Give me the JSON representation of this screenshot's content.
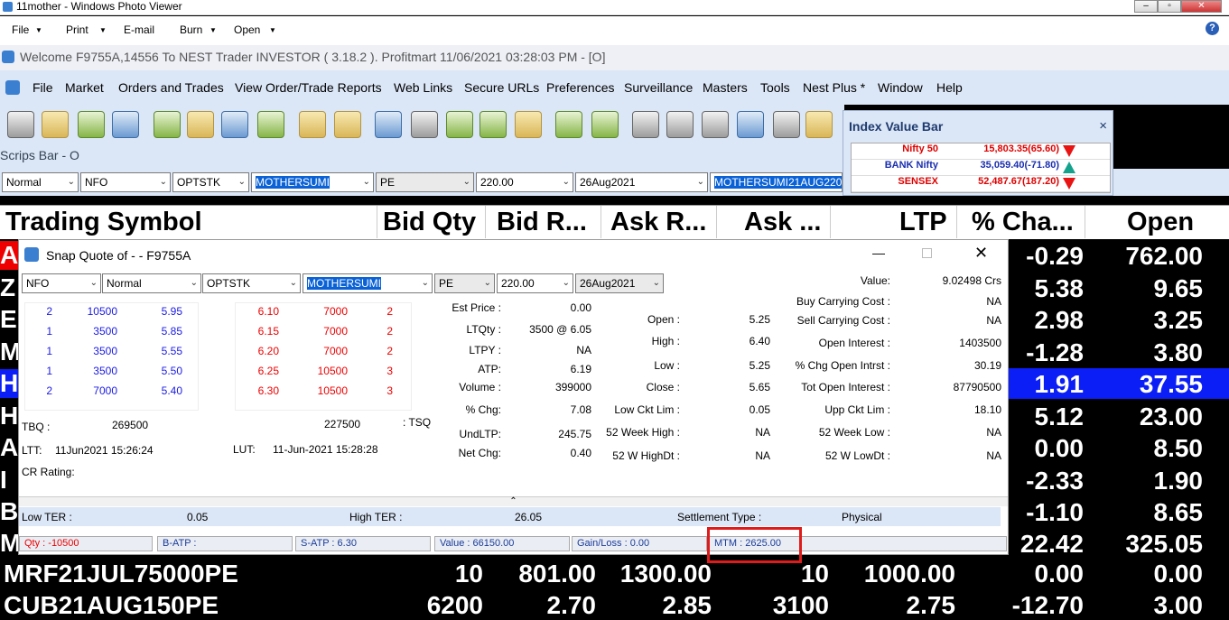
{
  "window": {
    "title": "11mother - Windows Photo Viewer",
    "menu": [
      "File",
      "Print",
      "E-mail",
      "Burn",
      "Open"
    ],
    "help": "?"
  },
  "welcome": "Welcome F9755A,14556 To NEST Trader INVESTOR ( 3.18.2 ).  Profitmart  11/06/2021  03:28:03 PM - [O]",
  "main_menu": [
    "File",
    "Market",
    "Orders and Trades",
    "View Order/Trade Reports",
    "Web Links",
    "Secure URLs",
    "Preferences",
    "Surveillance",
    "Masters",
    "Tools",
    "Nest Plus *",
    "Window",
    "Help"
  ],
  "scrips_bar": "Scrips Bar - O",
  "selectors": [
    "Normal",
    "NFO",
    "OPTSTK",
    "MOTHERSUMI",
    "PE",
    "220.00",
    "26Aug2021",
    "MOTHERSUMI21AUG220PE"
  ],
  "index_bar": {
    "title": "Index Value Bar",
    "close": "×",
    "rows": [
      {
        "name": "Nifty 50",
        "value": "15,803.35(65.60)",
        "dir": "down",
        "color": "#e00000"
      },
      {
        "name": "BANK Nifty",
        "value": "35,059.40(-71.80)",
        "dir": "up",
        "color": "#1a2fb0"
      },
      {
        "name": "SENSEX",
        "value": "52,487.67(187.20)",
        "dir": "down",
        "color": "#e00000"
      }
    ]
  },
  "market_watch": {
    "headers": [
      "Trading Symbol",
      "Bid Qty",
      "Bid R...",
      "Ask R...",
      "Ask ...",
      "LTP",
      "% Cha...",
      "Open"
    ],
    "left_letters": [
      "A",
      "Z",
      "E",
      "M",
      "H",
      "H",
      "A",
      "I",
      "B",
      "M"
    ],
    "pct_chg": [
      "-0.29",
      "5.38",
      "2.98",
      "-1.28",
      "1.91",
      "5.12",
      "0.00",
      "-2.33",
      "-1.10",
      "22.42"
    ],
    "open": [
      "762.00",
      "9.65",
      "3.25",
      "3.80",
      "37.55",
      "23.00",
      "8.50",
      "1.90",
      "8.65",
      "325.05"
    ],
    "bottom_rows": [
      [
        "MRF21JUL75000PE",
        "10",
        "801.00",
        "1300.00",
        "10",
        "1000.00",
        "0.00",
        "0.00"
      ],
      [
        "CUB21AUG150PE",
        "6200",
        "2.70",
        "2.85",
        "3100",
        "2.75",
        "-12.70",
        "3.00"
      ]
    ]
  },
  "snap_quote": {
    "title": "Snap Quote of  -  - F9755A",
    "selectors": [
      "NFO",
      "Normal",
      "OPTSTK",
      "MOTHERSUMI",
      "PE",
      "220.00",
      "26Aug2021"
    ],
    "bids": [
      [
        "2",
        "10500",
        "5.95"
      ],
      [
        "1",
        "3500",
        "5.85"
      ],
      [
        "1",
        "3500",
        "5.55"
      ],
      [
        "1",
        "3500",
        "5.50"
      ],
      [
        "2",
        "7000",
        "5.40"
      ]
    ],
    "asks": [
      [
        "6.10",
        "7000",
        "2"
      ],
      [
        "6.15",
        "7000",
        "2"
      ],
      [
        "6.20",
        "7000",
        "2"
      ],
      [
        "6.25",
        "10500",
        "3"
      ],
      [
        "6.30",
        "10500",
        "3"
      ]
    ],
    "tbq_label": "TBQ :",
    "tbq": "269500",
    "tsq": "227500",
    "tsq_label": ": TSQ",
    "ltt_label": "LTT:",
    "ltt": "11Jun2021 15:26:24",
    "lut_label": "LUT:",
    "lut": "11-Jun-2021 15:28:28",
    "cr_label": "CR Rating:",
    "c1": [
      [
        "Est Price :",
        "0.00"
      ],
      [
        "LTQty :",
        "3500 @ 6.05"
      ],
      [
        "LTPY :",
        "NA"
      ],
      [
        "ATP:",
        "6.19"
      ],
      [
        "Volume :",
        "399000"
      ],
      [
        "% Chg:",
        "7.08"
      ],
      [
        "UndLTP:",
        "245.75"
      ],
      [
        "Net Chg:",
        "0.40"
      ]
    ],
    "c2": [
      [
        "Open :",
        "5.25"
      ],
      [
        "High :",
        "6.40"
      ],
      [
        "Low :",
        "5.25"
      ],
      [
        "Close :",
        "5.65"
      ],
      [
        "Low Ckt Lim :",
        "0.05"
      ],
      [
        "52 Week High :",
        "NA"
      ],
      [
        "52 W HighDt :",
        "NA"
      ]
    ],
    "c3": [
      [
        "Value:",
        "9.02498 Crs"
      ],
      [
        "Buy Carrying Cost :",
        "NA"
      ],
      [
        "Sell Carrying Cost :",
        "NA"
      ],
      [
        "Open Interest :",
        "1403500"
      ],
      [
        "% Chg Open Intrst :",
        "30.19"
      ],
      [
        "Tot Open Interest :",
        "87790500"
      ],
      [
        "Upp Ckt Lim :",
        "18.10"
      ],
      [
        "52 Week Low :",
        "NA"
      ],
      [
        "52 W LowDt :",
        "NA"
      ]
    ],
    "low_ter_label": "Low TER :",
    "low_ter": "0.05",
    "high_ter_label": "High TER :",
    "high_ter": "26.05",
    "settle_label": "Settlement Type :",
    "settle": "Physical",
    "status": [
      "Qty : -10500",
      "B-ATP :",
      "S-ATP : 6.30",
      "Value : 66150.00",
      "Gain/Loss : 0.00",
      "MTM : 2625.00"
    ]
  }
}
